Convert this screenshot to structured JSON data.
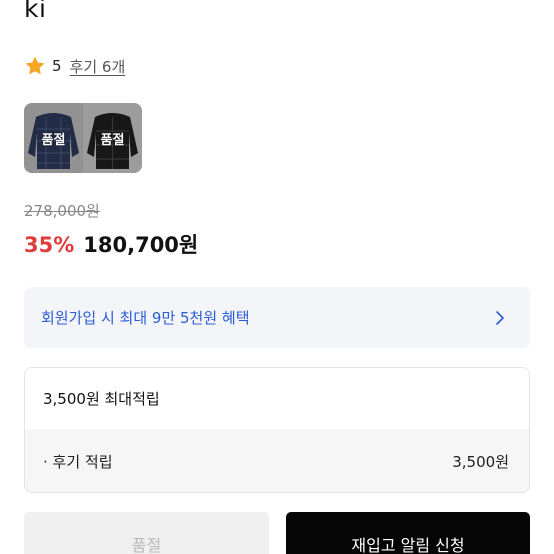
{
  "product": {
    "title": "ki",
    "rating": {
      "score": "5",
      "review_link": "후기 6개",
      "star_color": "#f5a623"
    },
    "options": [
      {
        "badge": "품절",
        "swatch": "navy-plaid"
      },
      {
        "badge": "품절",
        "swatch": "black"
      }
    ],
    "price": {
      "original": "278,000원",
      "discount": "35%",
      "sale": "180,700원",
      "discount_color": "#e23b3b"
    }
  },
  "benefit": {
    "text": "회원가입 시 최대 9만 5천원 혜택",
    "icon": "chevron-right-icon",
    "text_color": "#2a5bd7"
  },
  "points": {
    "header": "3,500원 최대적립",
    "rows": [
      {
        "label": "· 후기 적립",
        "value": "3,500원"
      }
    ]
  },
  "actions": {
    "soldout_label": "품절",
    "restock_label": "재입고 알림 신청"
  }
}
